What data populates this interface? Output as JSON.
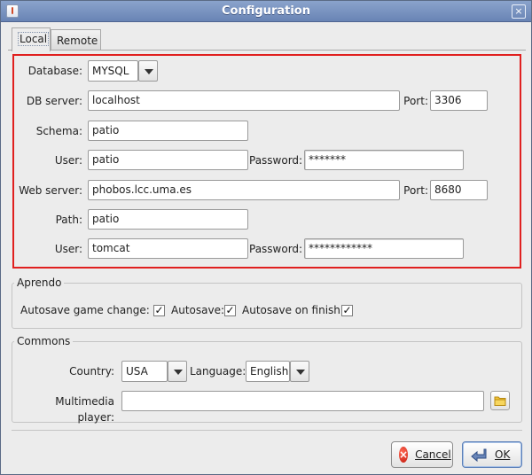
{
  "window": {
    "title": "Configuration",
    "close_glyph": "×"
  },
  "tabs": [
    {
      "label": "Local",
      "selected": true
    },
    {
      "label": "Remote",
      "selected": false
    }
  ],
  "local": {
    "database": {
      "label": "Database:",
      "value": "MYSQL"
    },
    "db_server": {
      "label": "DB server:",
      "value": "localhost"
    },
    "db_port": {
      "label": "Port:",
      "value": "3306"
    },
    "schema": {
      "label": "Schema:",
      "value": "patio"
    },
    "db_user": {
      "label": "User:",
      "value": "patio"
    },
    "db_password": {
      "label": "Password:",
      "value": "*******"
    },
    "web_server": {
      "label": "Web server:",
      "value": "phobos.lcc.uma.es"
    },
    "web_port": {
      "label": "Port:",
      "value": "8680"
    },
    "path": {
      "label": "Path:",
      "value": "patio"
    },
    "web_user": {
      "label": "User:",
      "value": "tomcat"
    },
    "web_password": {
      "label": "Password:",
      "value": "************"
    }
  },
  "aprendo": {
    "title": "Aprendo",
    "autosave_game_change": {
      "label": "Autosave game change:",
      "checked": true
    },
    "autosave": {
      "label": "Autosave:",
      "checked": true
    },
    "autosave_on_finish": {
      "label": "Autosave on finish:",
      "checked": true
    },
    "check_glyph": "✓"
  },
  "commons": {
    "title": "Commons",
    "country": {
      "label": "Country:",
      "value": "USA"
    },
    "language": {
      "label": "Language:",
      "value": "English"
    },
    "multimedia_player": {
      "label": "Multimedia player:",
      "value": ""
    }
  },
  "buttons": {
    "cancel": {
      "label": "Cancel",
      "icon": "cancel-icon",
      "icon_glyph": "×"
    },
    "ok": {
      "label": "OK",
      "icon": "ok-arrow-icon"
    }
  },
  "colors": {
    "highlight_border": "#e0201f",
    "titlebar": "#7893c2"
  }
}
